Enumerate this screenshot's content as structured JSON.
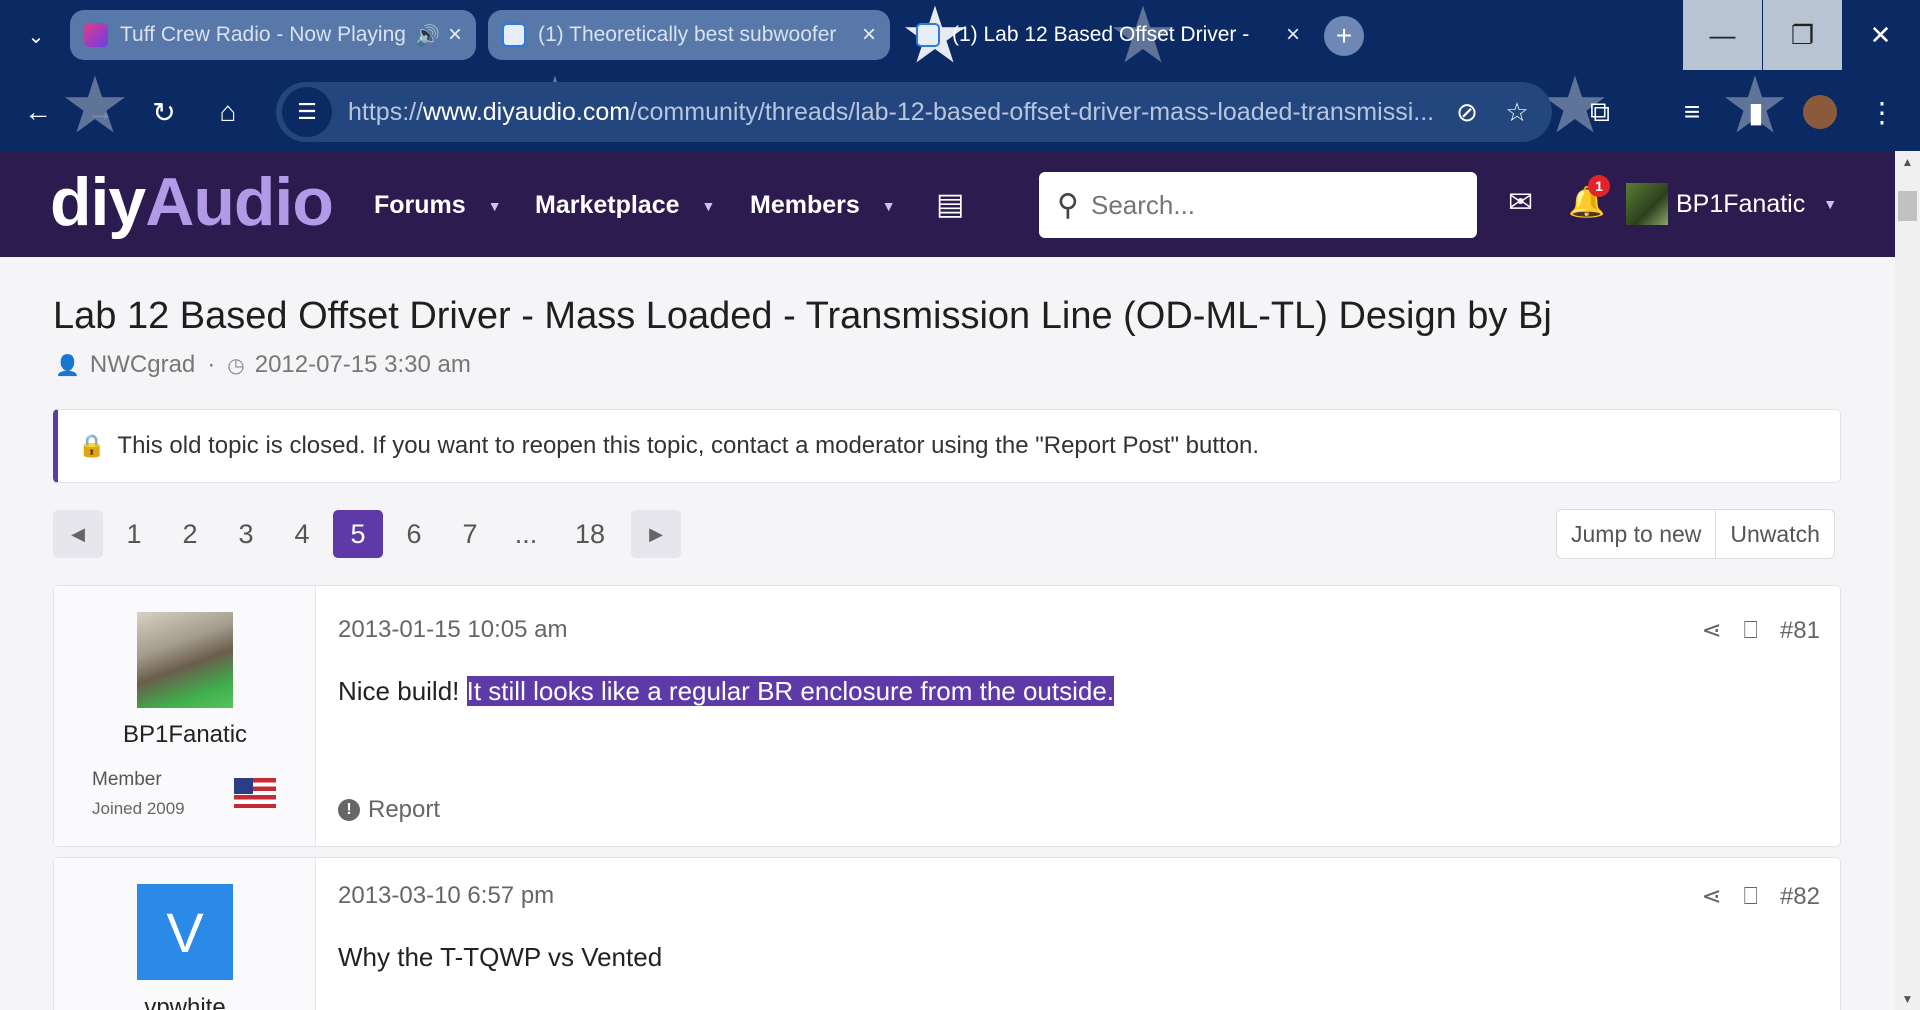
{
  "browser": {
    "tabs": [
      {
        "title": "Tuff Crew Radio - Now Playing",
        "audio": true
      },
      {
        "title": "(1) Theoretically best subwoofer"
      },
      {
        "title": "(1) Lab 12 Based Offset Driver -"
      }
    ],
    "url_prefix": "https://",
    "url_host": "www.diyaudio.com",
    "url_path": "/community/threads/lab-12-based-offset-driver-mass-loaded-transmissi...",
    "window_controls": [
      "—",
      "❐",
      "✕"
    ]
  },
  "site": {
    "logo_part1": "diy",
    "logo_part2": "Audio",
    "nav": [
      "Forums",
      "Marketplace",
      "Members"
    ],
    "search_placeholder": "Search...",
    "notification_count": "1",
    "username": "BP1Fanatic"
  },
  "thread": {
    "title": "Lab 12 Based Offset Driver - Mass Loaded - Transmission Line (OD-ML-TL) Design by Bj",
    "author": "NWCgrad",
    "date": "2012-07-15 3:30 am",
    "closed_notice": "This old topic is closed. If you want to reopen this topic, contact a moderator using the \"Report Post\" button.",
    "pages": [
      "1",
      "2",
      "3",
      "4",
      "5",
      "6",
      "7",
      "...",
      "18"
    ],
    "current_page": "5",
    "jump_label": "Jump to new",
    "unwatch_label": "Unwatch"
  },
  "posts": [
    {
      "author": "BP1Fanatic",
      "role": "Member",
      "joined": "Joined 2009",
      "date": "2013-01-15 10:05 am",
      "number": "#81",
      "body_plain": "Nice build! ",
      "body_highlight": "It still looks like a regular BR enclosure from the outside.",
      "report": "Report"
    },
    {
      "author": "vpwhite",
      "avatar_letter": "V",
      "date": "2013-03-10 6:57 pm",
      "number": "#82",
      "body": "Why the T-TQWP vs Vented"
    }
  ],
  "colors": {
    "browser_frame": "#0b2a63",
    "site_header": "#2c1b4f",
    "accent": "#5e3aa8",
    "logo_accent": "#b39ae6"
  }
}
